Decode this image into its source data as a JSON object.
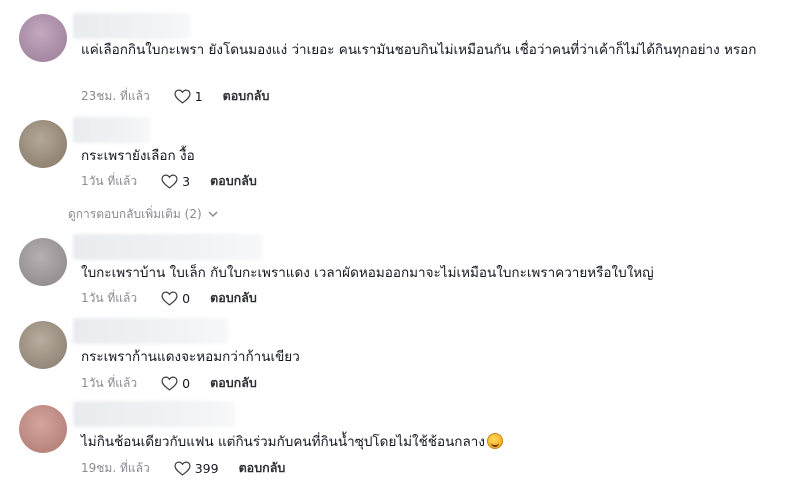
{
  "comments": [
    {
      "text": "แค่เลือกกินใบกะเพรา ยังโดนมองแง่ ว่าเยอะ คนเรามันชอบกินไม่เหมือนกัน เชื่อว่าคนที่ว่าเค้าก็ไม่ได้กินทุกอย่าง หรอก",
      "time": "23ชม. ที่แล้ว",
      "likes": "1",
      "reply": "ตอบกลับ",
      "avatar_color": "#b49ab0"
    },
    {
      "text": "กระเพรายังเลือก งื้อ",
      "time": "1วัน ที่แล้ว",
      "likes": "3",
      "reply": "ตอบกลับ",
      "avatar_color": "#9e9484"
    },
    {
      "text": "ใบกะเพราบ้าน ใบเล็ก กับใบกะเพราแดง เวลาผัดหอมออกมาจะไม่เหมือนใบกะเพราควายหรือใบใหญ่",
      "time": "1วัน ที่แล้ว",
      "likes": "0",
      "reply": "ตอบกลับ",
      "avatar_color": "#a29c9e"
    },
    {
      "text": "กระเพราก้านแดงจะหอมกว่าก้านเขียว",
      "time": "1วัน ที่แล้ว",
      "likes": "0",
      "reply": "ตอบกลับ",
      "avatar_color": "#a2978c"
    },
    {
      "text": "ไม่กินช้อนเดียวกับแฟน แต่กินร่วมกับคนที่กินน้ำซุปโดยไม่ใช้ช้อนกลาง",
      "time": "19ชม. ที่แล้ว",
      "likes": "399",
      "reply": "ตอบกลับ",
      "avatar_color": "#c49088"
    }
  ],
  "more_replies": "ดูการตอบกลับเพิ่มเติม (2)",
  "colors": {
    "text": "#161823",
    "muted": "#8a8b91",
    "background": "#ffffff"
  }
}
